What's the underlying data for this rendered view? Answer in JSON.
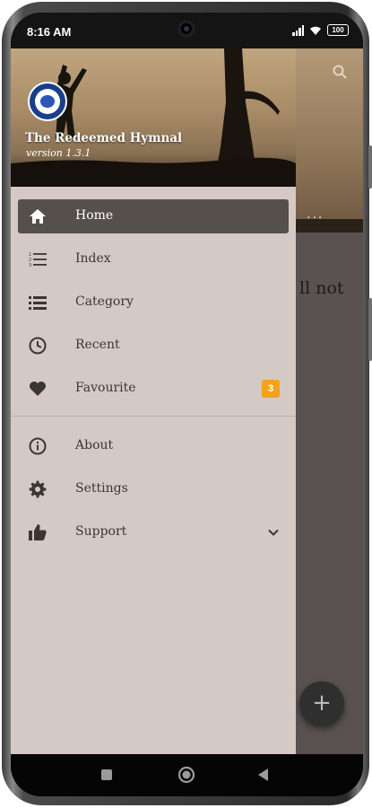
{
  "status_bar": {
    "time": "8:16 AM",
    "battery": "100",
    "icons": [
      "signal-icon",
      "wifi-icon",
      "battery-icon"
    ]
  },
  "background_app": {
    "visible_text": "ll not",
    "dots": "...",
    "fab_label": "+"
  },
  "drawer": {
    "header": {
      "title": "The Redeemed Hymnal",
      "version": "version 1.3.1"
    },
    "primary_items": [
      {
        "label": "Home",
        "icon": "home-icon",
        "active": true
      },
      {
        "label": "Index",
        "icon": "list-numbered-icon"
      },
      {
        "label": "Category",
        "icon": "list-icon"
      },
      {
        "label": "Recent",
        "icon": "clock-icon"
      },
      {
        "label": "Favourite",
        "icon": "heart-icon",
        "badge": "3"
      }
    ],
    "secondary_items": [
      {
        "label": "About",
        "icon": "info-icon"
      },
      {
        "label": "Settings",
        "icon": "gear-icon"
      },
      {
        "label": "Support",
        "icon": "thumbs-up-icon",
        "expandable": true
      }
    ]
  },
  "colors": {
    "drawer_bg": "#d4c9c5",
    "active_item_bg": "#56504d",
    "badge": "#f4a21c",
    "scrim": "#5a5250"
  },
  "nav_bar": {
    "buttons": [
      "recent-apps-icon",
      "home-circle-icon",
      "back-icon"
    ]
  }
}
